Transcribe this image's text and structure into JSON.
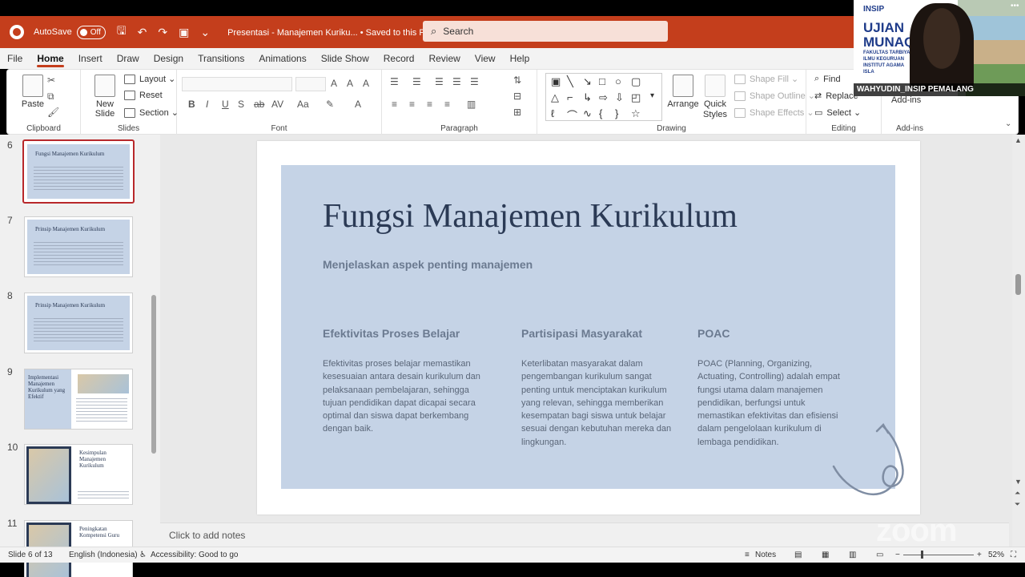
{
  "titlebar": {
    "autosave_label": "AutoSave",
    "autosave_state": "Off",
    "doc_title": "Presentasi - Manajemen Kuriku... • Saved to this PC ⌄",
    "search_placeholder": "Search"
  },
  "menu": {
    "tabs": [
      "File",
      "Home",
      "Insert",
      "Draw",
      "Design",
      "Transitions",
      "Animations",
      "Slide Show",
      "Record",
      "Review",
      "View",
      "Help"
    ],
    "active": "Home"
  },
  "ribbon": {
    "clipboard": {
      "paste": "Paste",
      "label": "Clipboard"
    },
    "slides": {
      "new_slide": "New Slide",
      "layout": "Layout ⌄",
      "reset": "Reset",
      "section": "Section ⌄",
      "label": "Slides"
    },
    "font": {
      "label": "Font"
    },
    "paragraph": {
      "label": "Paragraph"
    },
    "drawing": {
      "arrange": "Arrange",
      "quick_styles": "Quick Styles",
      "shape_fill": "Shape Fill ⌄",
      "shape_outline": "Shape Outline ⌄",
      "shape_effects": "Shape Effects ⌄",
      "label": "Drawing"
    },
    "editing": {
      "find": "Find",
      "replace": "Replace",
      "select": "Select ⌄",
      "label": "Editing"
    },
    "addins": {
      "addins": "Add-ins",
      "label": "Add-ins"
    }
  },
  "thumbnails": [
    {
      "num": "6",
      "title": "Fungsi Manajemen Kurikulum",
      "selected": true,
      "layout": "text"
    },
    {
      "num": "7",
      "title": "Prinsip Manajemen Kurikulum",
      "selected": false,
      "layout": "text"
    },
    {
      "num": "8",
      "title": "Prinsip Manajemen Kurikulum",
      "selected": false,
      "layout": "text"
    },
    {
      "num": "9",
      "title": "Implementasi Manajemen Kurikulum yang Efektif",
      "selected": false,
      "layout": "split-left"
    },
    {
      "num": "10",
      "title": "Kesimpulan Manajemen Kurikulum",
      "selected": false,
      "layout": "split-right"
    },
    {
      "num": "11",
      "title": "Peningkatan Kompetensi Guru",
      "selected": false,
      "layout": "split-right"
    }
  ],
  "slide": {
    "title": "Fungsi Manajemen Kurikulum",
    "subtitle": "Menjelaskan aspek penting manajemen",
    "columns": [
      {
        "heading": "Efektivitas Proses Belajar",
        "body": "Efektivitas proses belajar memastikan kesesuaian antara desain kurikulum dan pelaksanaan pembelajaran, sehingga tujuan pendidikan dapat dicapai secara optimal dan siswa dapat berkembang dengan baik."
      },
      {
        "heading": "Partisipasi Masyarakat",
        "body": "Keterlibatan masyarakat dalam pengembangan kurikulum sangat penting untuk menciptakan kurikulum yang relevan, sehingga memberikan kesempatan bagi siswa untuk belajar sesuai dengan kebutuhan mereka dan lingkungan."
      },
      {
        "heading": "POAC",
        "body": "POAC (Planning, Organizing, Actuating, Controlling) adalah empat fungsi utama dalam manajemen pendidikan, berfungsi untuk memastikan efektivitas dan efisiensi dalam pengelolaan kurikulum di lembaga pendidikan."
      }
    ],
    "background_color": "#c5d3e6",
    "title_color": "#2b3a55"
  },
  "notes_placeholder": "Click to add notes",
  "status": {
    "slide_of": "Slide 6 of 13",
    "language": "English (Indonesia)",
    "accessibility": "Accessibility: Good to go",
    "notes": "Notes",
    "zoom": "52%"
  },
  "zoom_overlay": {
    "logo": "INSIP",
    "exam": "UJIAN MUNAQO",
    "faculty": "FAKULTAS TARBIYA ILMU KEGURUAN INSTITUT AGAMA ISLA",
    "participant": "WAHYUDIN_INSIP PEMALANG",
    "watermark": "zoom"
  },
  "colors": {
    "accent": "#c43e1c",
    "slide_bg": "#c5d3e6"
  }
}
